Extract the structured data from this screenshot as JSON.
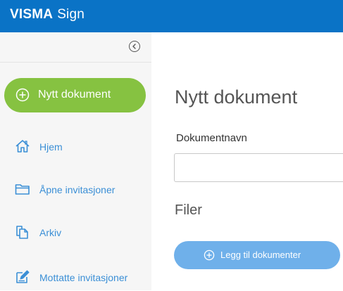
{
  "header": {
    "brand_bold": "VISMA",
    "brand_light": "Sign",
    "background_color": "#0a73c6"
  },
  "sidebar": {
    "collapse_icon": "chevron-left-circle-icon",
    "new_document": {
      "label": "Nytt dokument",
      "icon": "plus-circle-icon",
      "color": "#86c241"
    },
    "items": [
      {
        "label": "Hjem",
        "icon": "home-icon"
      },
      {
        "label": "Åpne invitasjoner",
        "icon": "folder-icon"
      },
      {
        "label": "Arkiv",
        "icon": "documents-icon"
      },
      {
        "label": "Mottatte invitasjoner",
        "icon": "edit-document-icon"
      }
    ],
    "link_color": "#3b8fd6"
  },
  "main": {
    "title": "Nytt dokument",
    "document_name_label": "Dokumentnavn",
    "document_name_value": "",
    "document_name_placeholder": "",
    "files_title": "Filer",
    "add_documents_button": {
      "label": "Legg til dokumenter",
      "icon": "plus-circle-icon",
      "color": "#6fb0ea"
    }
  }
}
